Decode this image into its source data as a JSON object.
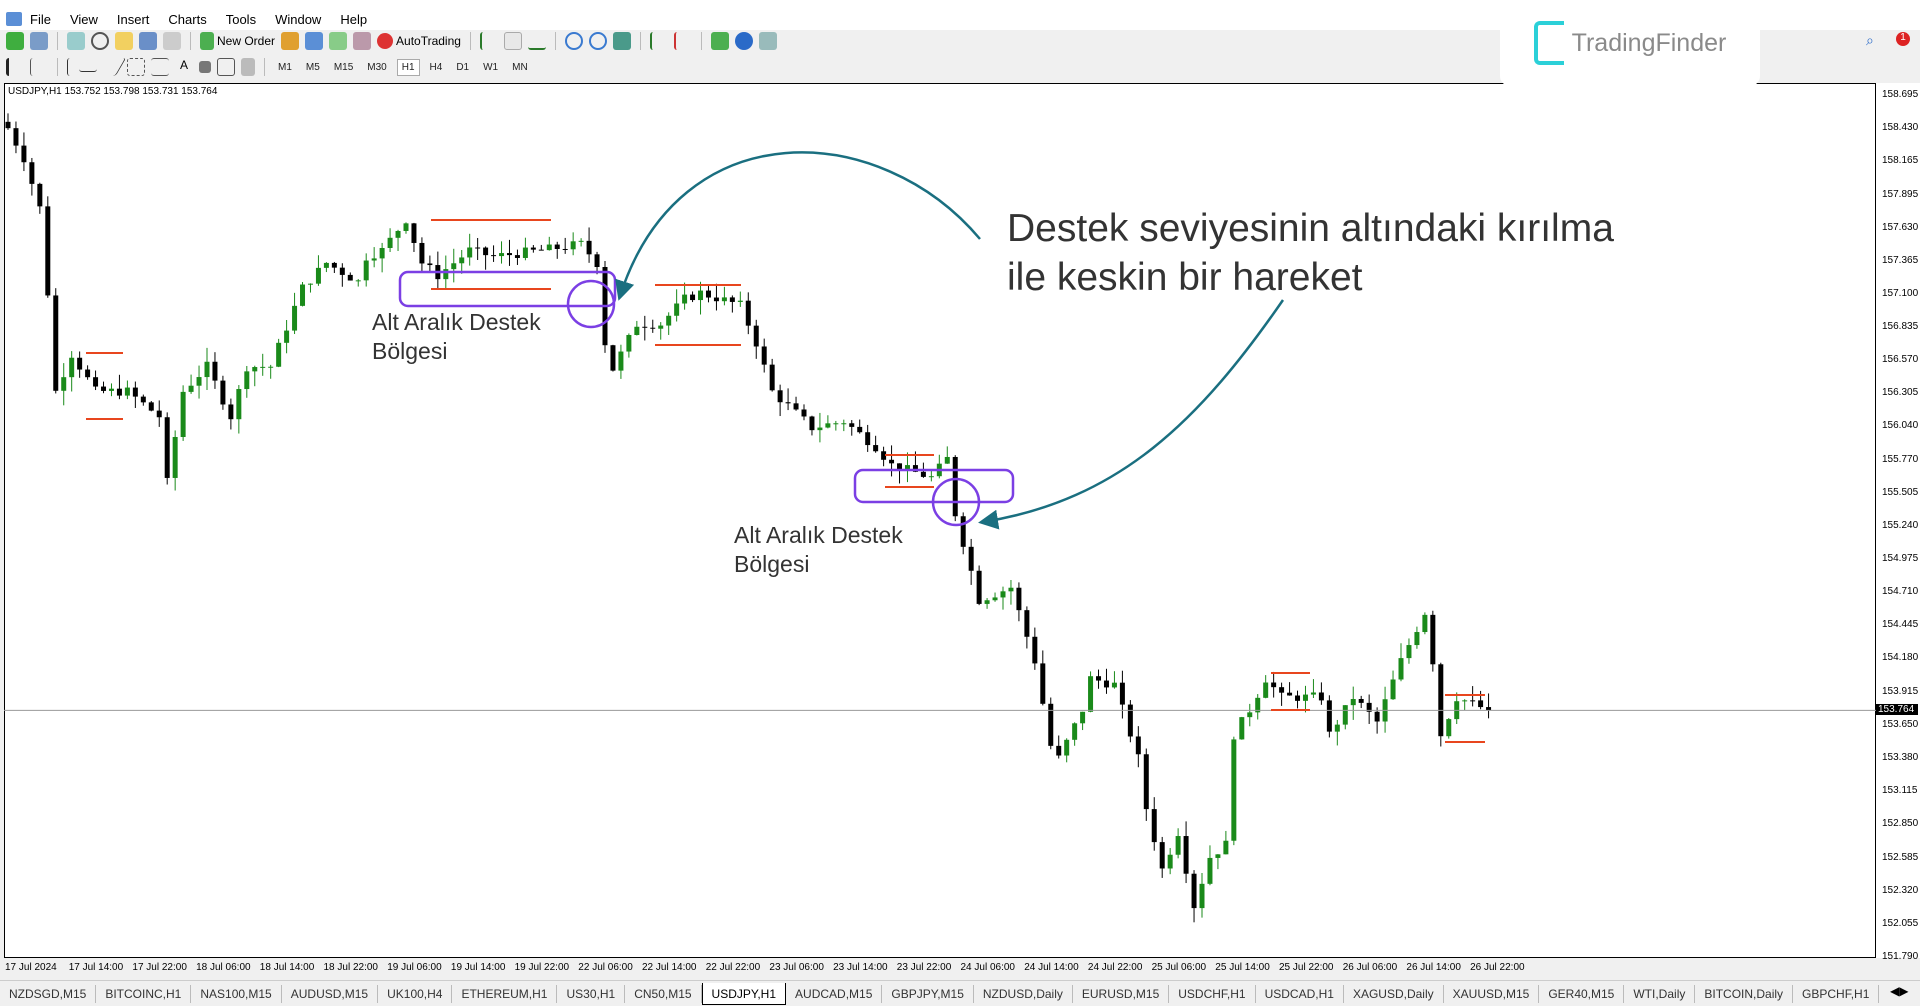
{
  "menu": [
    "File",
    "View",
    "Insert",
    "Charts",
    "Tools",
    "Window",
    "Help"
  ],
  "toolbar": {
    "new_order": "New Order",
    "auto_trading": "AutoTrading",
    "timeframes": [
      "M1",
      "M5",
      "M15",
      "M30",
      "H1",
      "H4",
      "D1",
      "W1",
      "MN"
    ],
    "active_timeframe": "H1"
  },
  "logo": "TradingFinder",
  "chart": {
    "info": "USDJPY,H1  153.752 153.798 153.731 153.764",
    "current_price": "153.764",
    "price_labels": [
      "158.695",
      "158.430",
      "158.165",
      "157.895",
      "157.630",
      "157.365",
      "157.100",
      "156.835",
      "156.570",
      "156.305",
      "156.040",
      "155.770",
      "155.505",
      "155.240",
      "154.975",
      "154.710",
      "154.445",
      "154.180",
      "153.915",
      "153.650",
      "153.380",
      "153.115",
      "152.850",
      "152.585",
      "152.320",
      "152.055",
      "151.790"
    ],
    "time_labels": [
      "17 Jul 2024",
      "17 Jul 14:00",
      "17 Jul 22:00",
      "18 Jul 06:00",
      "18 Jul 14:00",
      "18 Jul 22:00",
      "19 Jul 06:00",
      "19 Jul 14:00",
      "19 Jul 22:00",
      "22 Jul 06:00",
      "22 Jul 14:00",
      "22 Jul 22:00",
      "23 Jul 06:00",
      "23 Jul 14:00",
      "23 Jul 22:00",
      "24 Jul 06:00",
      "24 Jul 14:00",
      "24 Jul 22:00",
      "25 Jul 06:00",
      "25 Jul 14:00",
      "25 Jul 22:00",
      "26 Jul 06:00",
      "26 Jul 14:00",
      "26 Jul 22:00"
    ],
    "price_path": [
      [
        0,
        158.43
      ],
      [
        2,
        158.19
      ],
      [
        4,
        157.79
      ],
      [
        5,
        157.11
      ],
      [
        6,
        156.32
      ],
      [
        8,
        156.62
      ],
      [
        11,
        156.32
      ],
      [
        15,
        156.32
      ],
      [
        19,
        156.12
      ],
      [
        20,
        155.59
      ],
      [
        22,
        156.32
      ],
      [
        25,
        156.52
      ],
      [
        28,
        156.12
      ],
      [
        30,
        156.52
      ],
      [
        33,
        156.52
      ],
      [
        37,
        157.15
      ],
      [
        40,
        157.35
      ],
      [
        44,
        157.2
      ],
      [
        45,
        157.4
      ],
      [
        47,
        157.45
      ],
      [
        50,
        157.7
      ],
      [
        52,
        157.35
      ],
      [
        54,
        157.25
      ],
      [
        58,
        157.45
      ],
      [
        61,
        157.4
      ],
      [
        67,
        157.45
      ],
      [
        72,
        157.5
      ],
      [
        74,
        157.35
      ],
      [
        75,
        156.71
      ],
      [
        76,
        156.5
      ],
      [
        79,
        156.86
      ],
      [
        82,
        156.86
      ],
      [
        85,
        157.06
      ],
      [
        87,
        157.11
      ],
      [
        92,
        157.01
      ],
      [
        94,
        156.71
      ],
      [
        96,
        156.32
      ],
      [
        101,
        156.03
      ],
      [
        105,
        156.08
      ],
      [
        109,
        155.88
      ],
      [
        111,
        155.73
      ],
      [
        116,
        155.63
      ],
      [
        118,
        155.78
      ],
      [
        119,
        155.34
      ],
      [
        122,
        154.65
      ],
      [
        126,
        154.75
      ],
      [
        129,
        154.16
      ],
      [
        131,
        153.48
      ],
      [
        132,
        153.38
      ],
      [
        135,
        153.77
      ],
      [
        136,
        154.02
      ],
      [
        139,
        153.97
      ],
      [
        142,
        153.38
      ],
      [
        143,
        152.98
      ],
      [
        145,
        152.49
      ],
      [
        147,
        152.79
      ],
      [
        149,
        152.2
      ],
      [
        151,
        152.59
      ],
      [
        153,
        152.69
      ],
      [
        154,
        153.57
      ],
      [
        156,
        153.77
      ],
      [
        158,
        154.02
      ],
      [
        160,
        153.87
      ],
      [
        165,
        153.87
      ],
      [
        166,
        153.57
      ],
      [
        169,
        153.87
      ],
      [
        172,
        153.67
      ],
      [
        175,
        154.16
      ],
      [
        178,
        154.55
      ],
      [
        179,
        154.16
      ],
      [
        180,
        153.57
      ],
      [
        182,
        153.87
      ],
      [
        186,
        153.764
      ]
    ],
    "colors": {
      "bull": "#1a8a1a",
      "bear": "#000000",
      "levels": "#e8461e",
      "zone": "#7b3fe4",
      "arrow": "#1a6f80"
    }
  },
  "annotations": {
    "zone1": [
      "Alt Aralık Destek",
      "Bölgesi"
    ],
    "zone2": [
      "Alt Aralık Destek",
      "Bölgesi"
    ],
    "headline": [
      "Destek seviyesinin altındaki kırılma",
      "ile keskin bir hareket"
    ]
  },
  "tabs": [
    "NZDSGD,M15",
    "BITCOINC,H1",
    "NAS100,M15",
    "AUDUSD,M15",
    "UK100,H4",
    "ETHEREUM,H1",
    "US30,H1",
    "CN50,M15",
    "USDJPY,H1",
    "AUDCAD,M15",
    "GBPJPY,M15",
    "NZDUSD,Daily",
    "EURUSD,M15",
    "USDCHF,H1",
    "USDCAD,H1",
    "XAGUSD,Daily",
    "XAUUSD,M15",
    "GER40,M15",
    "WTI,Daily",
    "BITCOIN,Daily",
    "GBPCHF,H1"
  ],
  "active_tab": "USDJPY,H1"
}
